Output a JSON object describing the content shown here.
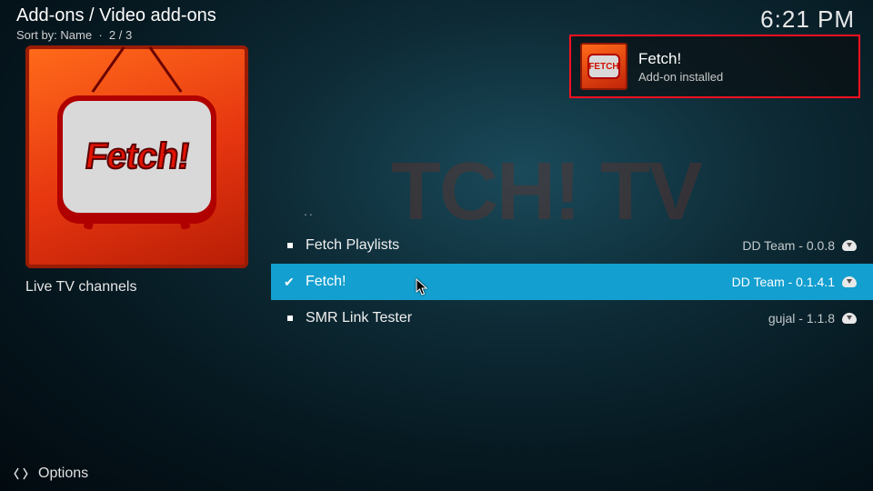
{
  "header": {
    "breadcrumb": "Add-ons / Video add-ons",
    "sort_label": "Sort by:",
    "sort_value": "Name",
    "position": "2 / 3"
  },
  "clock": "6:21 PM",
  "side": {
    "logo_text": "Fetch!",
    "description": "Live TV channels"
  },
  "watermark": "TCH! TV",
  "parent_label": "..",
  "items": [
    {
      "name": "Fetch Playlists",
      "meta": "DD Team - 0.0.8",
      "selected": false
    },
    {
      "name": "Fetch!",
      "meta": "DD Team - 0.1.4.1",
      "selected": true
    },
    {
      "name": "SMR Link Tester",
      "meta": "gujal - 1.1.8",
      "selected": false
    }
  ],
  "notification": {
    "title": "Fetch!",
    "message": "Add-on installed"
  },
  "footer": {
    "options_label": "Options"
  }
}
